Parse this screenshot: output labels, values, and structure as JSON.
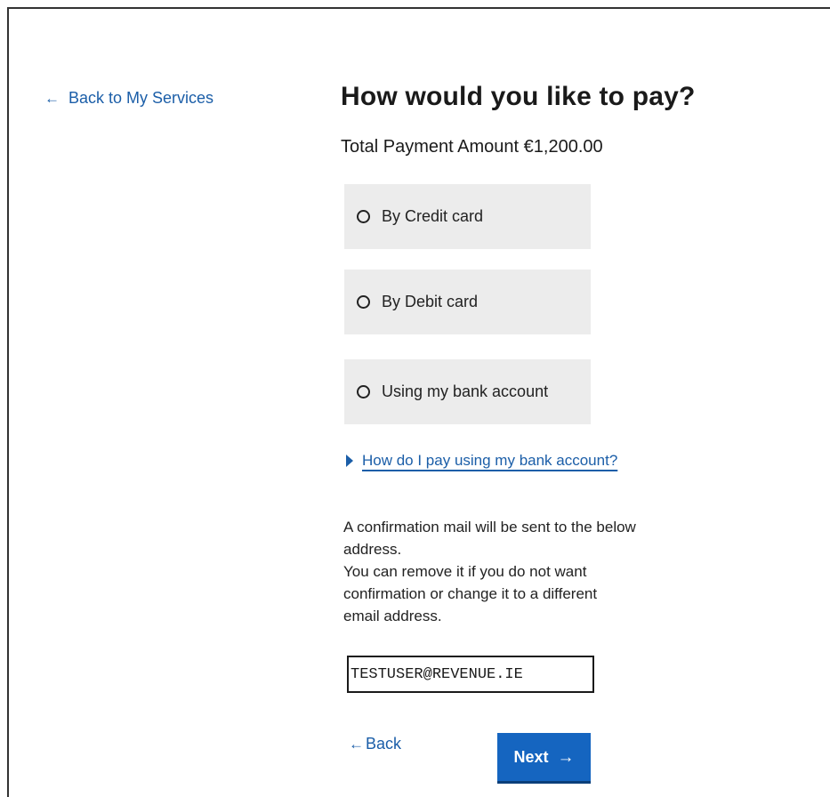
{
  "nav": {
    "back_services_label": "Back to My Services",
    "back_arrow": "←"
  },
  "page": {
    "title": "How would you like to pay?",
    "total_label": "Total Payment Amount €1,200.00"
  },
  "payment_options": [
    {
      "label": "By Credit card",
      "selected": false
    },
    {
      "label": "By Debit card",
      "selected": false
    },
    {
      "label": "Using my bank account",
      "selected": false
    }
  ],
  "help": {
    "bank_account_link": "How do I pay using my bank account?"
  },
  "confirmation": {
    "line1": "A confirmation mail will be sent to the below address.",
    "line2": "You can remove it if you do not want confirmation or change it to a different email address.",
    "email_value": "TESTUSER@REVENUE.IE"
  },
  "actions": {
    "back_arrow": "←",
    "back_label": "Back",
    "next_label": "Next",
    "next_arrow": "→"
  },
  "colors": {
    "link": "#1b5ea8",
    "primary_button": "#1565c0",
    "option_background": "#ececec"
  }
}
